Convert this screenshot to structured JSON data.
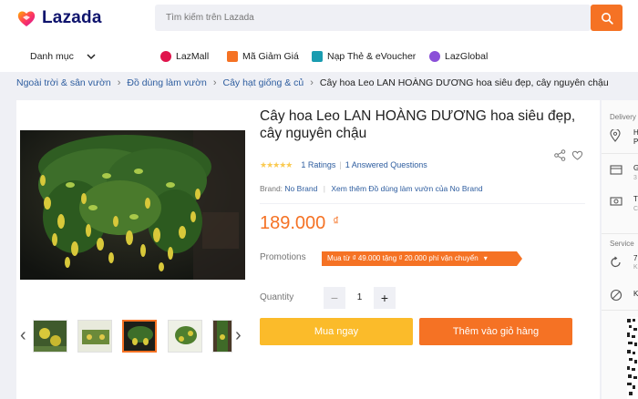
{
  "header": {
    "logo_text": "Lazada",
    "search_placeholder": "Tìm kiếm trên Lazada",
    "category_label": "Danh mục",
    "nav": [
      {
        "label": "LazMall",
        "icon": "lazmall-icon",
        "color": "#e0144c"
      },
      {
        "label": "Mã Giảm Giá",
        "icon": "voucher-icon",
        "color": "#f57224"
      },
      {
        "label": "Nạp Thẻ & eVoucher",
        "icon": "topup-icon",
        "color": "#1a9cb0"
      },
      {
        "label": "LazGlobal",
        "icon": "lazglobal-icon",
        "color": "#8a4fd8"
      }
    ]
  },
  "breadcrumb": {
    "items": [
      "Ngoài trời & sân vườn",
      "Đồ dùng làm vườn",
      "Cây hạt giống & củ"
    ],
    "current": "Cây hoa Leo LAN HOÀNG DƯƠNG hoa siêu đẹp, cây nguyên chậu"
  },
  "product": {
    "title": "Cây hoa Leo LAN HOÀNG DƯƠNG hoa siêu đẹp, cây nguyên chậu",
    "stars": "★★★★★",
    "ratings": "1 Ratings",
    "answered": "1 Answered Questions",
    "brand_label": "Brand:",
    "brand": "No Brand",
    "brand_more": "Xem thêm Đồ dùng làm vườn của No Brand",
    "price": "189.000",
    "currency": "₫",
    "promotions_label": "Promotions",
    "promo": "Mua từ ₫ 49.000 tặng ₫ 20.000 phí vận chuyển",
    "quantity_label": "Quantity",
    "quantity": "1",
    "buy_now": "Mua ngay",
    "add_to_cart": "Thêm vào giỏ hàng"
  },
  "side": {
    "delivery_label": "Delivery",
    "delivery_line1": "H",
    "delivery_line2": "P",
    "service_label": "Service",
    "row1": "G",
    "row1_sub": "3",
    "row2": "T",
    "row2_sub": "C",
    "row3": "7",
    "row3_sub": "K",
    "row4": "K"
  },
  "colors": {
    "accent": "#f57224",
    "buy": "#fbbb2a",
    "link": "#2e5d9f",
    "brand": "#0f146d"
  }
}
